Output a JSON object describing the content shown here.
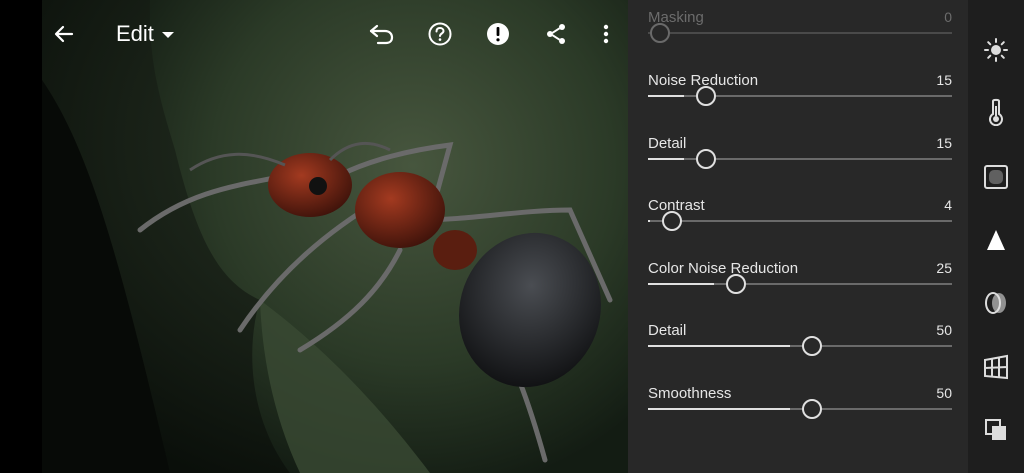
{
  "toolbar": {
    "back_icon": "back-arrow-icon",
    "title": "Edit",
    "undo_icon": "undo-icon",
    "help_icon": "help-icon",
    "alert_icon": "exclamation-icon",
    "share_icon": "share-icon",
    "more_icon": "more-vertical-icon"
  },
  "detail_panel": {
    "rows": [
      {
        "label": "Masking",
        "value": "0",
        "level": 0,
        "disabled": true
      },
      {
        "label": "Noise Reduction",
        "value": "15",
        "level": 0.15
      },
      {
        "label": "Detail",
        "value": "15",
        "level": 0.15
      },
      {
        "label": "Contrast",
        "value": "4",
        "level": 0.04
      },
      {
        "label": "Color Noise Reduction",
        "value": "25",
        "level": 0.25
      },
      {
        "label": "Detail",
        "value": "50",
        "level": 0.5
      },
      {
        "label": "Smoothness",
        "value": "50",
        "level": 0.5
      }
    ]
  },
  "tool_rail": {
    "items": [
      "light-icon",
      "color-temperature-icon",
      "effects-icon",
      "detail-icon",
      "optics-icon",
      "geometry-icon",
      "versions-icon"
    ],
    "active": "detail-icon"
  },
  "colors": {
    "panel_bg": "#282828",
    "rail_bg": "#1e1e1e",
    "slider_fill": "#e0e0e0",
    "slider_track": "#6a6a6a"
  }
}
